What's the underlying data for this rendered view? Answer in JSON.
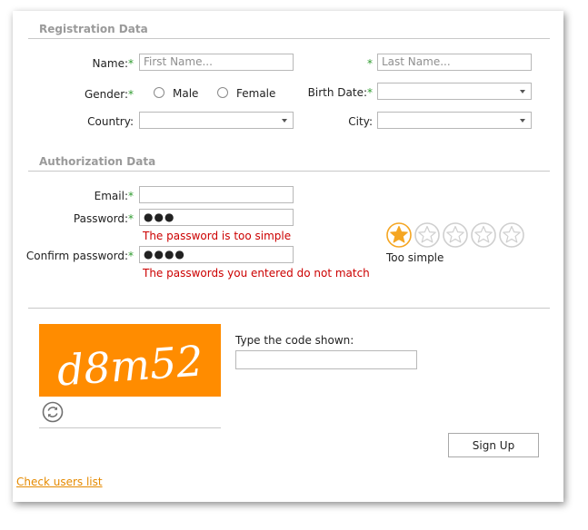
{
  "registration": {
    "title": "Registration Data",
    "name_label": "Name:",
    "required_mark": "*",
    "first_name_placeholder": "First Name...",
    "last_name_placeholder": "Last Name...",
    "gender_label": "Gender:",
    "gender_options": [
      "Male",
      "Female"
    ],
    "birth_date_label": "Birth Date:",
    "birth_date_value": "",
    "country_label": "Country:",
    "country_value": "",
    "city_label": "City:",
    "city_value": ""
  },
  "authorization": {
    "title": "Authorization Data",
    "email_label": "Email:",
    "email_value": "",
    "password_label": "Password:",
    "password_value": "●●●",
    "password_error": "The password is too simple",
    "confirm_label": "Confirm password:",
    "confirm_value": "●●●●",
    "confirm_error": "The passwords you entered do not match",
    "strength_rating": 1,
    "strength_max": 5,
    "strength_text": "Too simple"
  },
  "captcha": {
    "code": "d8m52",
    "prompt": "Type the code shown:",
    "input_value": ""
  },
  "actions": {
    "sign_up_label": "Sign Up",
    "users_link": "Check users list"
  },
  "colors": {
    "captcha_bg": "#ff8c00",
    "star_active": "#f5a623",
    "error": "#cc0000",
    "link": "#e58a00",
    "required": "#2e9b2e"
  }
}
